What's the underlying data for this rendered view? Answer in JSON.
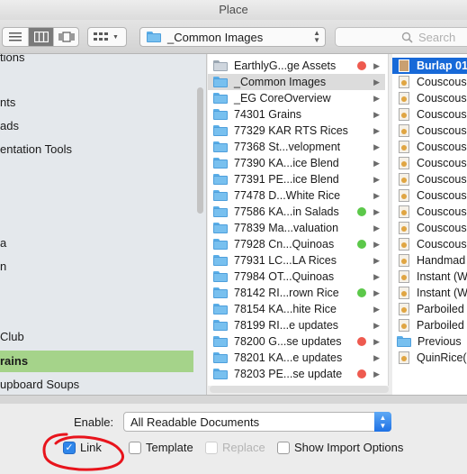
{
  "window": {
    "title": "Place"
  },
  "toolbar": {
    "view_modes": [
      {
        "name": "list-view",
        "active": false
      },
      {
        "name": "column-view",
        "active": true
      },
      {
        "name": "cover-flow-view",
        "active": false
      }
    ],
    "location": {
      "label": "_Common Images"
    },
    "search": {
      "placeholder": "Search"
    }
  },
  "sidebar": {
    "items": [
      {
        "label": "tions"
      },
      {
        "label": ""
      },
      {
        "label": "nts"
      },
      {
        "label": "ads"
      },
      {
        "label": "entation Tools"
      },
      {
        "label": ""
      },
      {
        "label": ""
      },
      {
        "label": ""
      },
      {
        "label": "a"
      },
      {
        "label": "n"
      },
      {
        "label": ""
      },
      {
        "label": ""
      },
      {
        "label": "Club"
      },
      {
        "label": "rains",
        "selected": true
      },
      {
        "label": "upboard Soups"
      }
    ]
  },
  "column2": {
    "items": [
      {
        "label": "EarthlyG...ge Assets",
        "tag": "#ee5a4f",
        "icon": "folder-icon"
      },
      {
        "label": "_Common Images",
        "selected": true
      },
      {
        "label": "_EG CoreOverview"
      },
      {
        "label": "74301 Grains"
      },
      {
        "label": "77329 KAR RTS Rices"
      },
      {
        "label": "77368 St...velopment"
      },
      {
        "label": "77390 KA...ice Blend"
      },
      {
        "label": "77391 PE...ice Blend"
      },
      {
        "label": "77478 D...White Rice"
      },
      {
        "label": "77586 KA...in Salads",
        "tag": "#5cc84a"
      },
      {
        "label": "77839 Ma...valuation"
      },
      {
        "label": "77928 Cn...Quinoas",
        "tag": "#5cc84a"
      },
      {
        "label": "77931 LC...LA Rices"
      },
      {
        "label": "77984 OT...Quinoas"
      },
      {
        "label": "78142 RI...rown Rice",
        "tag": "#5cc84a"
      },
      {
        "label": "78154 KA...hite Rice"
      },
      {
        "label": "78199 RI...e updates"
      },
      {
        "label": "78200 G...se updates",
        "tag": "#ee5a4f"
      },
      {
        "label": "78201 KA...e updates"
      },
      {
        "label": "78203 PE...se update",
        "tag": "#ee5a4f"
      }
    ]
  },
  "column3": {
    "items": [
      {
        "label": "Burlap 01",
        "active": true
      },
      {
        "label": "Couscous"
      },
      {
        "label": "Couscous"
      },
      {
        "label": "Couscous"
      },
      {
        "label": "Couscous"
      },
      {
        "label": "Couscous"
      },
      {
        "label": "Couscous"
      },
      {
        "label": "Couscous"
      },
      {
        "label": "Couscous"
      },
      {
        "label": "Couscous"
      },
      {
        "label": "Couscous"
      },
      {
        "label": "Couscous"
      },
      {
        "label": "Handmad"
      },
      {
        "label": "Instant (W"
      },
      {
        "label": "Instant (W"
      },
      {
        "label": "Parboiled"
      },
      {
        "label": "Parboiled"
      },
      {
        "label": "Previous",
        "folder": true
      },
      {
        "label": "QuinRice("
      }
    ]
  },
  "options": {
    "enable_label": "Enable:",
    "enable_value": "All Readable Documents",
    "checkboxes": [
      {
        "label": "Link",
        "checked": true,
        "disabled": false
      },
      {
        "label": "Template",
        "checked": false,
        "disabled": false
      },
      {
        "label": "Replace",
        "checked": false,
        "disabled": true
      },
      {
        "label": "Show Import Options",
        "checked": false,
        "disabled": false
      }
    ]
  },
  "colors": {
    "selection_blue": "#1769d8",
    "sidebar_selected": "#a5d38a",
    "annotation_red": "#e8141c",
    "tag_red": "#ee5a4f",
    "tag_green": "#5cc84a"
  }
}
